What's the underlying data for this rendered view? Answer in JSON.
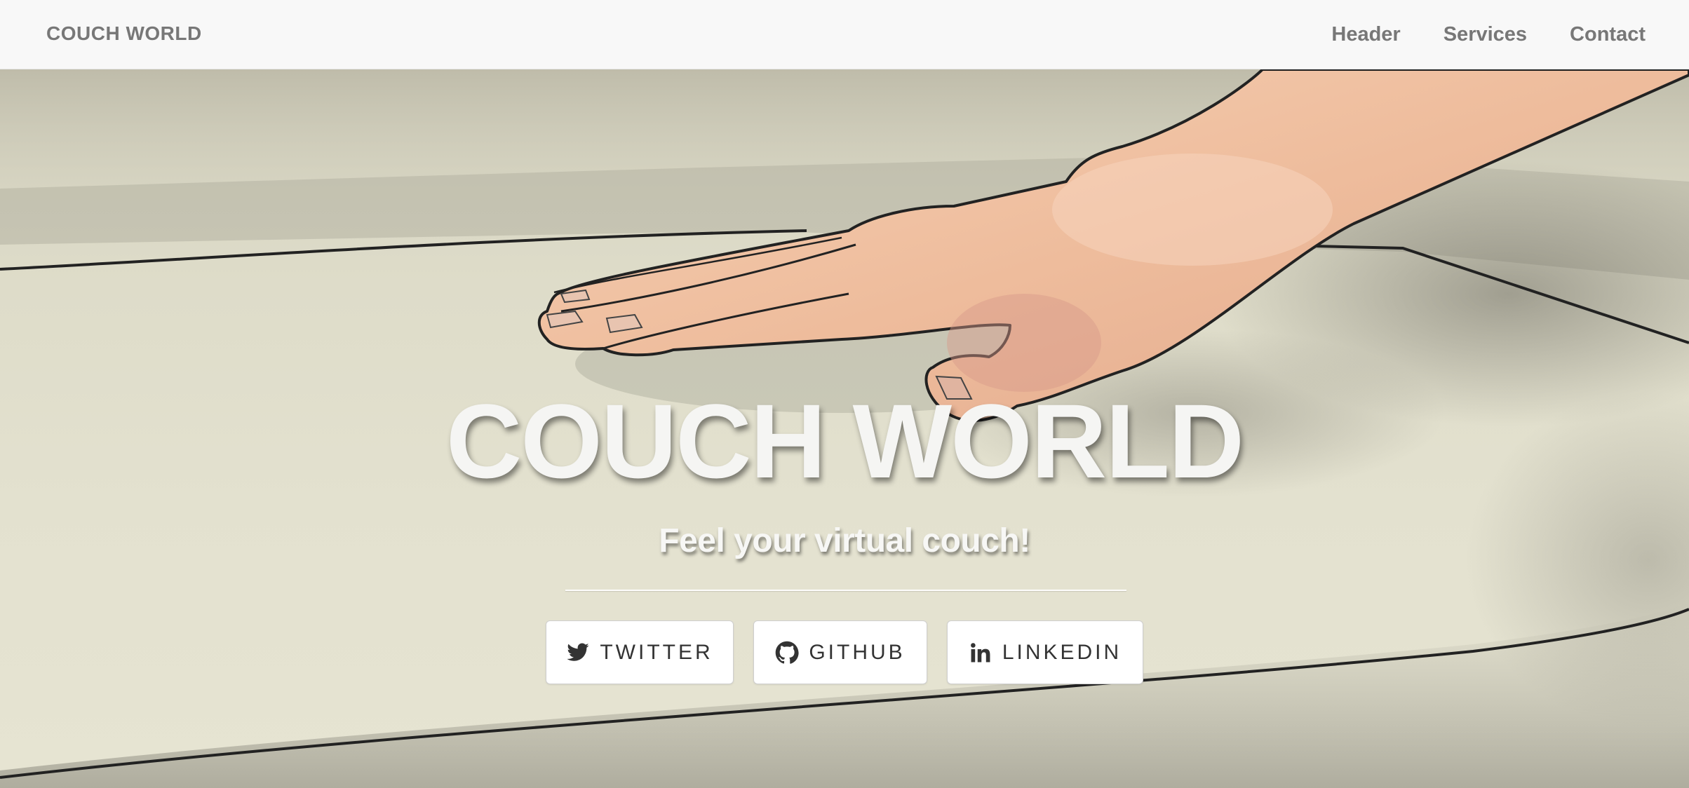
{
  "navbar": {
    "brand": "COUCH WORLD",
    "links": [
      "Header",
      "Services",
      "Contact"
    ]
  },
  "hero": {
    "title": "COUCH WORLD",
    "subtitle": "Feel your virtual couch!",
    "buttons": [
      {
        "label": "TWITTER",
        "icon": "twitter-icon"
      },
      {
        "label": "GITHUB",
        "icon": "github-icon"
      },
      {
        "label": "LINKEDIN",
        "icon": "linkedin-icon"
      }
    ],
    "background_image": "illustration of a hand pressing on a couch cushion"
  },
  "colors": {
    "navbar_bg": "#f8f8f8",
    "nav_text": "#777777",
    "hero_text": "#f5f5f3",
    "button_bg": "#ffffff",
    "button_text": "#333333",
    "skin": "#f0c0a0"
  }
}
